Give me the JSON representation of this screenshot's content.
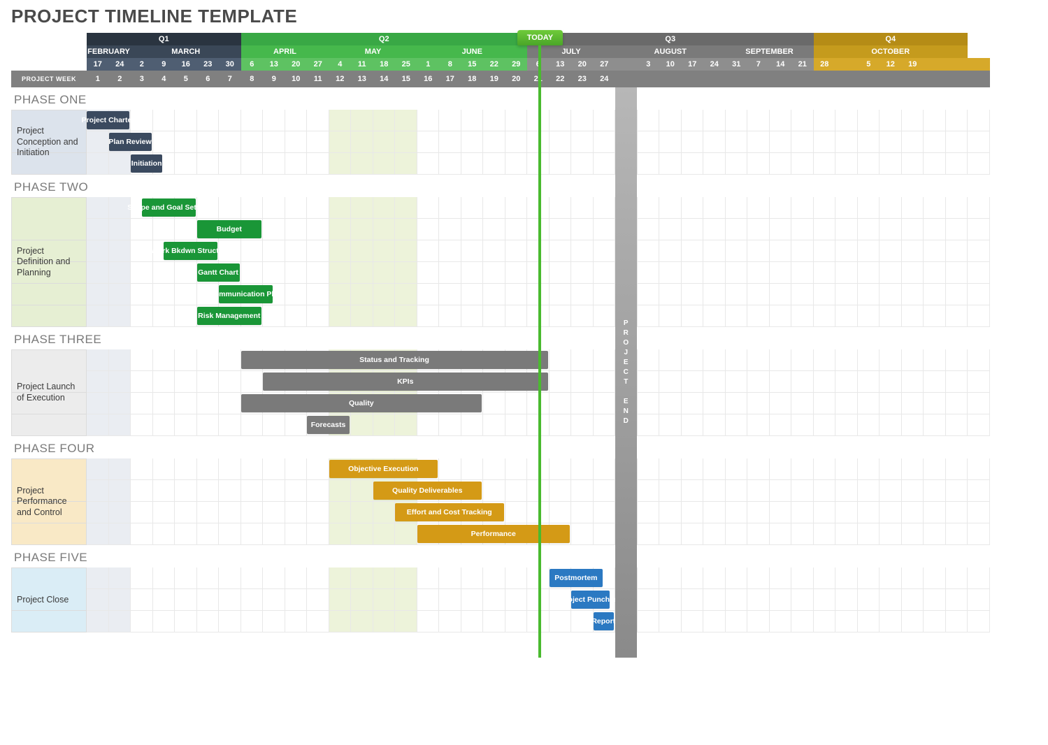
{
  "title": "PROJECT TIMELINE TEMPLATE",
  "today_label": "TODAY",
  "project_end_label": "PROJECT END",
  "project_week_label": "PROJECT WEEK",
  "chart_data": {
    "type": "gantt",
    "today_week": 21,
    "project_end_week": 25,
    "quarters": [
      {
        "name": "Q1",
        "span": 7
      },
      {
        "name": "Q2",
        "span": 13
      },
      {
        "name": "Q3",
        "span": 13
      },
      {
        "name": "Q4",
        "span": 7
      }
    ],
    "months": [
      {
        "name": "FEBRUARY",
        "span": 2,
        "cls": "m-feb"
      },
      {
        "name": "MARCH",
        "span": 5,
        "cls": "m-mar"
      },
      {
        "name": "APRIL",
        "span": 4,
        "cls": "m-apr"
      },
      {
        "name": "MAY",
        "span": 4,
        "cls": "m-may"
      },
      {
        "name": "JUNE",
        "span": 5,
        "cls": "m-jun"
      },
      {
        "name": "JULY",
        "span": 4,
        "cls": "m-jul"
      },
      {
        "name": "AUGUST",
        "span": 5,
        "cls": "m-aug"
      },
      {
        "name": "SEPTEMBER",
        "span": 4,
        "cls": "m-sep"
      },
      {
        "name": "OCTOBER",
        "span": 7,
        "cls": "m-oct"
      }
    ],
    "days": [
      "17",
      "24",
      "2",
      "9",
      "16",
      "23",
      "30",
      "6",
      "13",
      "20",
      "27",
      "4",
      "11",
      "18",
      "25",
      "1",
      "8",
      "15",
      "22",
      "29",
      "6",
      "13",
      "20",
      "27",
      "",
      "3",
      "10",
      "17",
      "24",
      "31",
      "7",
      "14",
      "21",
      "28",
      "",
      "5",
      "12",
      "19",
      "",
      "",
      ""
    ],
    "weeks": [
      "1",
      "2",
      "3",
      "4",
      "5",
      "6",
      "7",
      "8",
      "9",
      "10",
      "11",
      "12",
      "13",
      "14",
      "15",
      "16",
      "17",
      "18",
      "19",
      "20",
      "21",
      "22",
      "23",
      "24",
      "",
      "",
      "",
      "",
      "",
      "",
      "",
      "",
      "",
      "",
      "",
      "",
      "",
      "",
      "",
      "",
      ""
    ],
    "phases": [
      {
        "title": "PHASE ONE",
        "label": "Project Conception and Initiation",
        "label_cls": "pl-blue",
        "rows": 3,
        "tasks": [
          {
            "name": "Project Charter",
            "start": 1,
            "span": 2,
            "row": 0,
            "color": "c-navy"
          },
          {
            "name": "Plan Review",
            "start": 2,
            "span": 2,
            "row": 1,
            "color": "c-navy"
          },
          {
            "name": "Initiation",
            "start": 3,
            "span": 1.5,
            "row": 2,
            "color": "c-navy"
          }
        ]
      },
      {
        "title": "PHASE TWO",
        "label": "Project Definition and Planning",
        "label_cls": "pl-greenish",
        "rows": 6,
        "tasks": [
          {
            "name": "Scope and Goal Setting",
            "start": 3.5,
            "span": 2.5,
            "row": 0,
            "color": "c-green"
          },
          {
            "name": "Budget",
            "start": 6,
            "span": 3,
            "row": 1,
            "color": "c-green"
          },
          {
            "name": "Work Bkdwn Structure",
            "start": 4.5,
            "span": 2.5,
            "row": 2,
            "color": "c-green"
          },
          {
            "name": "Gantt Chart",
            "start": 6,
            "span": 2,
            "row": 3,
            "color": "c-green"
          },
          {
            "name": "Communication Plan",
            "start": 7,
            "span": 2.5,
            "row": 4,
            "color": "c-green"
          },
          {
            "name": "Risk Management",
            "start": 6,
            "span": 3,
            "row": 5,
            "color": "c-green"
          }
        ]
      },
      {
        "title": "PHASE THREE",
        "label": "Project Launch of Execution",
        "label_cls": "pl-grey",
        "rows": 4,
        "tasks": [
          {
            "name": "Status  and Tracking",
            "start": 8,
            "span": 14,
            "row": 0,
            "color": "c-grey"
          },
          {
            "name": "KPIs",
            "start": 9,
            "span": 13,
            "row": 1,
            "color": "c-grey"
          },
          {
            "name": "Quality",
            "start": 8,
            "span": 11,
            "row": 2,
            "color": "c-grey"
          },
          {
            "name": "Forecasts",
            "start": 11,
            "span": 2,
            "row": 3,
            "color": "c-grey"
          }
        ]
      },
      {
        "title": "PHASE FOUR",
        "label": "Project Performance and Control",
        "label_cls": "pl-cream",
        "rows": 4,
        "tasks": [
          {
            "name": "Objective Execution",
            "start": 12,
            "span": 5,
            "row": 0,
            "color": "c-gold"
          },
          {
            "name": "Quality Deliverables",
            "start": 14,
            "span": 5,
            "row": 1,
            "color": "c-gold"
          },
          {
            "name": "Effort and Cost Tracking",
            "start": 15,
            "span": 5,
            "row": 2,
            "color": "c-gold"
          },
          {
            "name": "Performance",
            "start": 16,
            "span": 7,
            "row": 3,
            "color": "c-gold"
          }
        ]
      },
      {
        "title": "PHASE FIVE",
        "label": "Project Close",
        "label_cls": "pl-lblue",
        "rows": 3,
        "tasks": [
          {
            "name": "Postmortem",
            "start": 22,
            "span": 2.5,
            "row": 0,
            "color": "c-blue"
          },
          {
            "name": "Project Punchlist",
            "start": 23,
            "span": 1.8,
            "row": 1,
            "color": "c-blue"
          },
          {
            "name": "Report",
            "start": 24,
            "span": 1,
            "row": 2,
            "color": "c-blue"
          }
        ]
      }
    ]
  }
}
